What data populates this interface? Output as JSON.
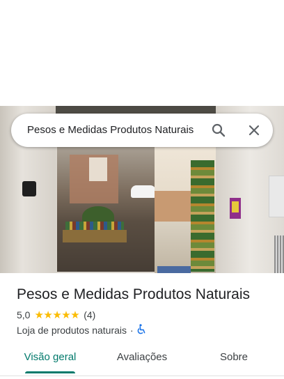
{
  "search": {
    "query": "Pesos e Medidas Produtos Naturais"
  },
  "icons": {
    "search": "search-icon",
    "close": "close-icon",
    "accessibility": "wheelchair-icon"
  },
  "place": {
    "name": "Pesos e Medidas Produtos Naturais",
    "rating": "5,0",
    "stars": "★★★★★",
    "review_count": "(4)",
    "category": "Loja de produtos naturais",
    "separator": "·"
  },
  "tabs": [
    {
      "label": "Visão geral",
      "active": true
    },
    {
      "label": "Avaliações",
      "active": false
    },
    {
      "label": "Sobre",
      "active": false
    }
  ],
  "colors": {
    "accent": "#00796b",
    "star": "#fbbc04",
    "accessibility": "#1a73e8"
  }
}
